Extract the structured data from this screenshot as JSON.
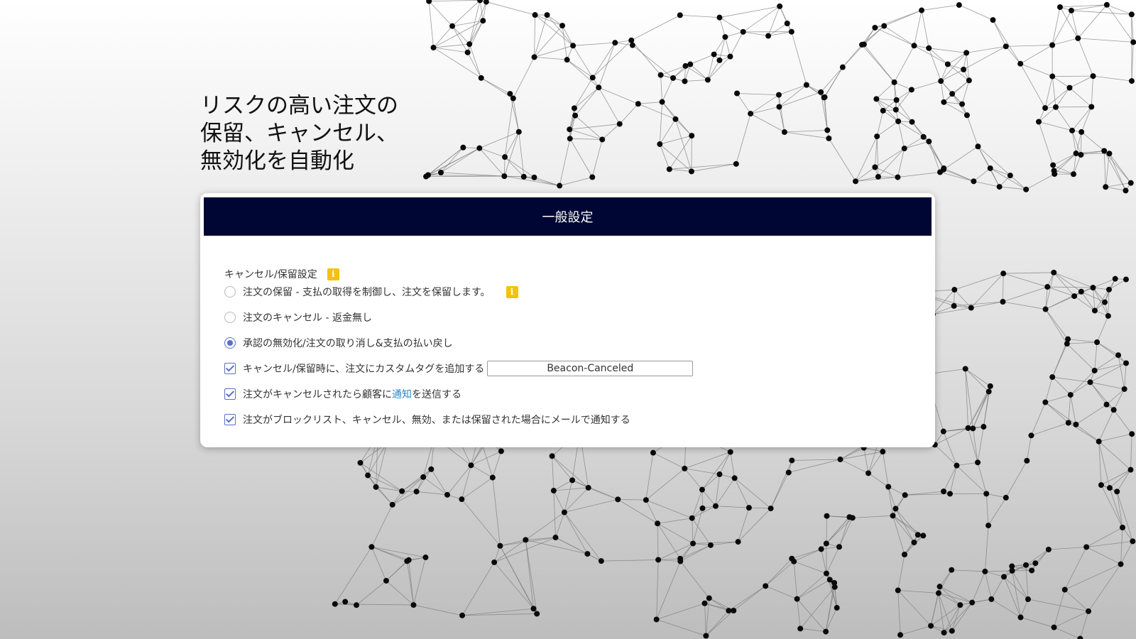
{
  "headline": {
    "line1": "リスクの高い注文の",
    "line2": "保留、キャンセル、",
    "line3": "無効化を自動化"
  },
  "panel": {
    "title": "一般設定",
    "section_label": "キャンセル/保留設定",
    "info_icon_glyph": "i",
    "options": {
      "hold_label": "注文の保留 - 支払の取得を制御し、注文を保留します。",
      "hold_selected": false,
      "cancel_label": "注文のキャンセル - 返金無し",
      "cancel_selected": false,
      "void_label": "承認の無効化/注文の取り消し&支払の払い戻し",
      "void_selected": true
    },
    "checks": {
      "tag_label": "キャンセル/保留時に、注文にカスタムタグを追加する",
      "tag_checked": true,
      "tag_value": "Beacon-Canceled",
      "notify_before": "注文がキャンセルされたら顧客に",
      "notify_link": "通知",
      "notify_after": "を送信する",
      "notify_checked": true,
      "email_label": "注文がブロックリスト、キャンセル、無効、または保留された場合にメールで通知する",
      "email_checked": true
    }
  },
  "colors": {
    "header_bg": "#000633",
    "accent": "#5b6fc7",
    "info_icon": "#f4c20d",
    "link": "#2f86c9"
  }
}
